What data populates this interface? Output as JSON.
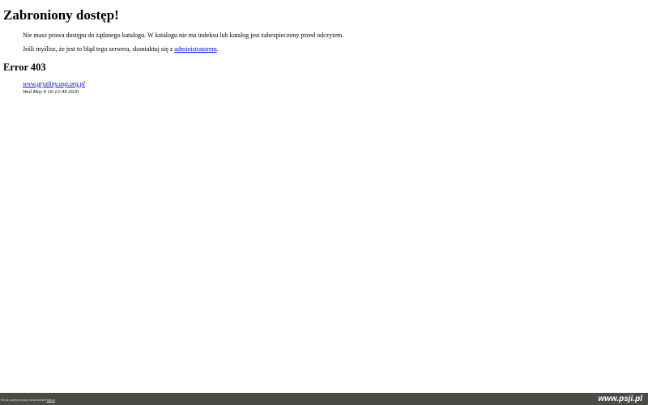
{
  "page": {
    "title": "Zabroniony dostęp!",
    "message_1": "Nie masz prawa dostępu do żądanego katalogu. W katalogu nie ma indeksu lub katalog jest zabezpieczony przed odczytem.",
    "message_2_before": "Jeśli myślisz, że jest to błąd tego serwera, skontaktuj się z ",
    "message_2_link": "administratorem",
    "message_2_after": ".",
    "error_heading": "Error 403",
    "server_host": "www.gryzliny.osp.org.pl",
    "timestamp": "Wed May 6 16:13:49 2020"
  },
  "footer": {
    "note_text": "Serwis utrzymywany na serwerach ",
    "note_link": "psji.pl",
    "logo_text": "www.psji.pl"
  },
  "colors": {
    "link": "#0000ee",
    "footer_bg": "#4a4b44",
    "footer_text": "#ffffff"
  }
}
